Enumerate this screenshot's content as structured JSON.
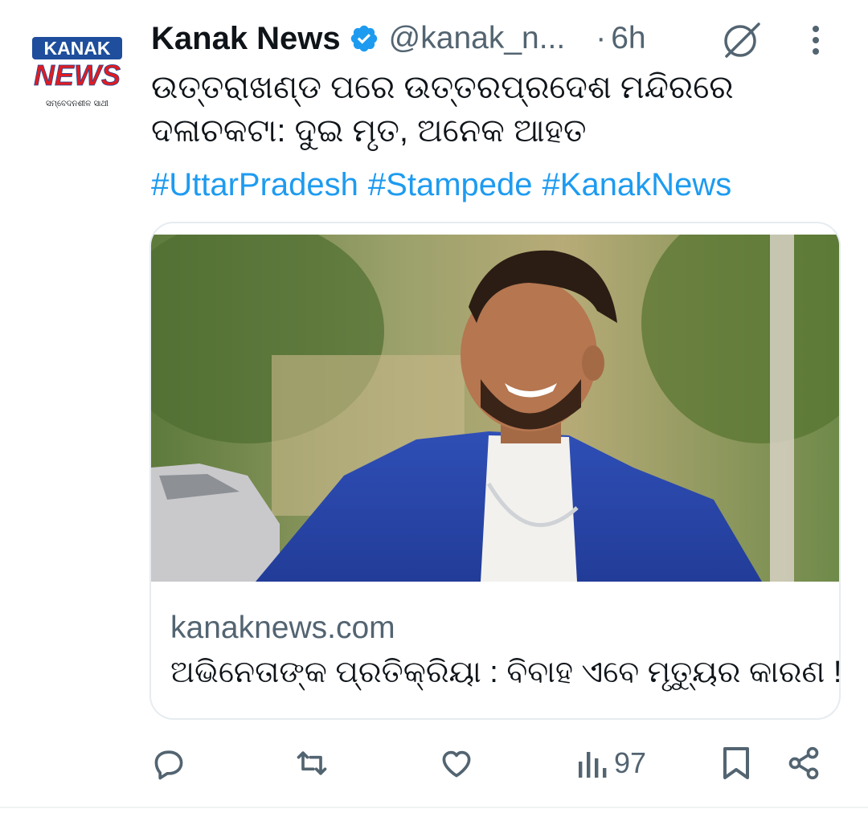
{
  "account": {
    "name": "Kanak News",
    "handle": "@kanak_n...",
    "separator": "·",
    "time": "6h",
    "avatar": {
      "logo_top": "KANAK",
      "logo_main": "NEWS",
      "tagline": "ସମ୍ବେଦନଶୀଳ ସାଥୀ",
      "brand_red": "#e11b22",
      "brand_blue": "#1e4e9c"
    }
  },
  "tweet": {
    "text": "ଉତ୍ତରାଖଣ୍ଡ ପରେ ଉତ୍ତରପ୍ରଦେଶ ମନ୍ଦିରରେ ଦଳାଚକଟା: ଦୁଇ ମୃତ, ଅନେକ ଆହତ",
    "hashtags": [
      "#UttarPradesh",
      "#Stampede",
      "#KanakNews"
    ]
  },
  "card": {
    "domain": "kanaknews.com",
    "title": "ଅଭିନେତାଙ୍କ ପ୍ରତିକ୍ରିୟା : ବିବାହ ଏବେ ମୃତ୍ୟୁର କାରଣ !"
  },
  "actions": {
    "reply_icon": "reply-icon",
    "retweet_icon": "retweet-icon",
    "like_icon": "heart-icon",
    "views_icon": "views-icon",
    "views_count": "97",
    "bookmark_icon": "bookmark-icon",
    "share_icon": "share-icon"
  },
  "colors": {
    "link": "#1d9bf0",
    "secondary_text": "#536471",
    "primary_text": "#0f1419",
    "verified": "#1d9bf0"
  }
}
